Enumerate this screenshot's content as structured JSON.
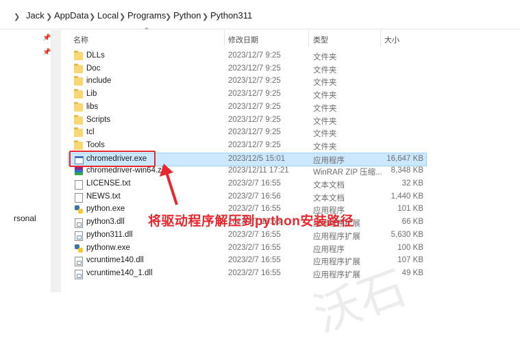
{
  "breadcrumb": [
    "Jack",
    "AppData",
    "Local",
    "Programs",
    "Python",
    "Python311"
  ],
  "nav": {
    "partial_label": "rsonal"
  },
  "columns": {
    "name": "名称",
    "date": "修改日期",
    "type": "类型",
    "size": "大小"
  },
  "files": [
    {
      "name": "DLLs",
      "date": "2023/12/7 9:25",
      "type": "文件夹",
      "size": "",
      "icon": "folder-icon"
    },
    {
      "name": "Doc",
      "date": "2023/12/7 9:25",
      "type": "文件夹",
      "size": "",
      "icon": "folder-icon"
    },
    {
      "name": "include",
      "date": "2023/12/7 9:25",
      "type": "文件夹",
      "size": "",
      "icon": "folder-icon"
    },
    {
      "name": "Lib",
      "date": "2023/12/7 9:25",
      "type": "文件夹",
      "size": "",
      "icon": "folder-icon"
    },
    {
      "name": "libs",
      "date": "2023/12/7 9:25",
      "type": "文件夹",
      "size": "",
      "icon": "folder-icon"
    },
    {
      "name": "Scripts",
      "date": "2023/12/7 9:25",
      "type": "文件夹",
      "size": "",
      "icon": "folder-icon"
    },
    {
      "name": "tcl",
      "date": "2023/12/7 9:25",
      "type": "文件夹",
      "size": "",
      "icon": "folder-icon"
    },
    {
      "name": "Tools",
      "date": "2023/12/7 9:25",
      "type": "文件夹",
      "size": "",
      "icon": "folder-icon"
    },
    {
      "name": "chromedriver.exe",
      "date": "2023/12/5 15:01",
      "type": "应用程序",
      "size": "16,647 KB",
      "icon": "exe-icon",
      "selected": true
    },
    {
      "name": "chromedriver-win64.zi",
      "date": "2023/12/11 17:21",
      "type": "WinRAR ZIP 压缩...",
      "size": "8,348 KB",
      "icon": "winrar-icon"
    },
    {
      "name": "LICENSE.txt",
      "date": "2023/2/7 16:55",
      "type": "文本文档",
      "size": "32 KB",
      "icon": "text-file-icon"
    },
    {
      "name": "NEWS.txt",
      "date": "2023/2/7 16:56",
      "type": "文本文档",
      "size": "1,440 KB",
      "icon": "text-file-icon"
    },
    {
      "name": "python.exe",
      "date": "2023/2/7 16:55",
      "type": "应用程序",
      "size": "101 KB",
      "icon": "python-icon"
    },
    {
      "name": "python3.dll",
      "date": "2023/2/7 16:55",
      "type": "应用程序扩展",
      "size": "66 KB",
      "icon": "dll-icon"
    },
    {
      "name": "python311.dll",
      "date": "2023/2/7 16:55",
      "type": "应用程序扩展",
      "size": "5,630 KB",
      "icon": "dll-icon"
    },
    {
      "name": "pythonw.exe",
      "date": "2023/2/7 16:55",
      "type": "应用程序",
      "size": "100 KB",
      "icon": "python-icon"
    },
    {
      "name": "vcruntime140.dll",
      "date": "2023/2/7 16:55",
      "type": "应用程序扩展",
      "size": "107 KB",
      "icon": "dll-icon"
    },
    {
      "name": "vcruntime140_1.dll",
      "date": "2023/2/7 16:55",
      "type": "应用程序扩展",
      "size": "49 KB",
      "icon": "dll-icon"
    }
  ],
  "annotation": {
    "text": "将驱动程序解压到python安装路径",
    "color": "#e8282e"
  },
  "colors": {
    "selection": "#cce8ff",
    "selection_border": "#99d1ff",
    "folder": "#f8d775"
  }
}
